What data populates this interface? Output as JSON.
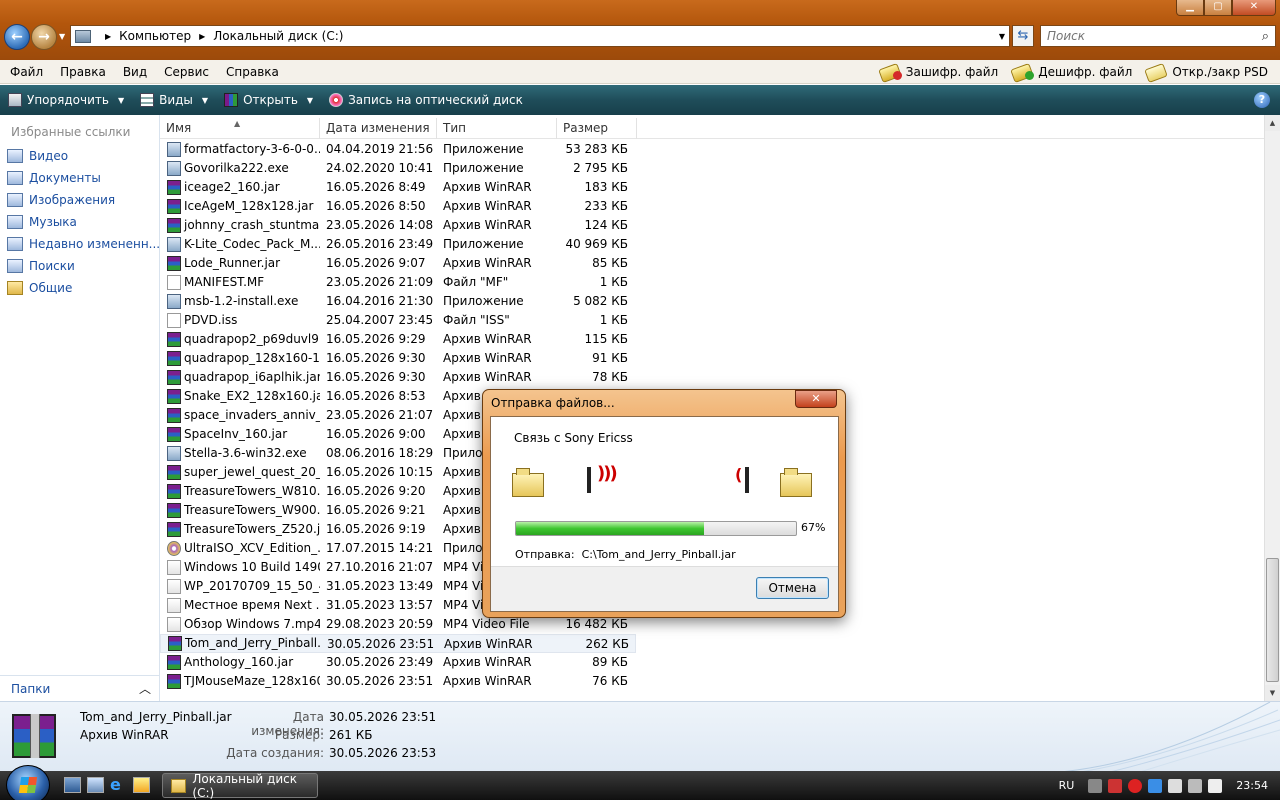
{
  "address": {
    "segments": [
      "Компьютер",
      "Локальный диск (C:)"
    ],
    "search_placeholder": "Поиск"
  },
  "menu": {
    "items": [
      "Файл",
      "Правка",
      "Вид",
      "Сервис",
      "Справка"
    ],
    "extras": [
      "Зашифр. файл",
      "Дешифр. файл",
      "Откр./закр PSD"
    ]
  },
  "toolbar": {
    "organize": "Упорядочить",
    "views": "Виды",
    "open": "Открыть",
    "burn": "Запись на оптический диск"
  },
  "nav": {
    "header": "Избранные ссылки",
    "links": [
      "Видео",
      "Документы",
      "Изображения",
      "Музыка",
      "Недавно измененн...",
      "Поиски",
      "Общие"
    ],
    "folders_label": "Папки"
  },
  "columns": [
    "Имя",
    "Дата изменения",
    "Тип",
    "Размер"
  ],
  "files": [
    {
      "name": "formatfactory-3-6-0-0...",
      "date": "04.04.2019 21:56",
      "type": "Приложение",
      "size": "53 283 КБ",
      "icon": "app"
    },
    {
      "name": "Govorilka222.exe",
      "date": "24.02.2020 10:41",
      "type": "Приложение",
      "size": "2 795 КБ",
      "icon": "app"
    },
    {
      "name": "iceage2_160.jar",
      "date": "16.05.2026 8:49",
      "type": "Архив WinRAR",
      "size": "183 КБ",
      "icon": "rar"
    },
    {
      "name": "IceAgeM_128x128.jar",
      "date": "16.05.2026 8:50",
      "type": "Архив WinRAR",
      "size": "233 КБ",
      "icon": "rar"
    },
    {
      "name": "johnny_crash_stuntma...",
      "date": "23.05.2026 14:08",
      "type": "Архив WinRAR",
      "size": "124 КБ",
      "icon": "rar"
    },
    {
      "name": "K-Lite_Codec_Pack_M...",
      "date": "26.05.2016 23:49",
      "type": "Приложение",
      "size": "40 969 КБ",
      "icon": "app"
    },
    {
      "name": "Lode_Runner.jar",
      "date": "16.05.2026 9:07",
      "type": "Архив WinRAR",
      "size": "85 КБ",
      "icon": "rar"
    },
    {
      "name": "MANIFEST.MF",
      "date": "23.05.2026 21:09",
      "type": "Файл \"MF\"",
      "size": "1 КБ",
      "icon": "txt"
    },
    {
      "name": "msb-1.2-install.exe",
      "date": "16.04.2016 21:30",
      "type": "Приложение",
      "size": "5 082 КБ",
      "icon": "app"
    },
    {
      "name": "PDVD.iss",
      "date": "25.04.2007 23:45",
      "type": "Файл \"ISS\"",
      "size": "1 КБ",
      "icon": "txt"
    },
    {
      "name": "quadrapop2_p69duvl9....",
      "date": "16.05.2026 9:29",
      "type": "Архив WinRAR",
      "size": "115 КБ",
      "icon": "rar"
    },
    {
      "name": "quadrapop_128x160-12...",
      "date": "16.05.2026 9:30",
      "type": "Архив WinRAR",
      "size": "91 КБ",
      "icon": "rar"
    },
    {
      "name": "quadrapop_i6aplhik.jar",
      "date": "16.05.2026 9:30",
      "type": "Архив WinRAR",
      "size": "78 КБ",
      "icon": "rar"
    },
    {
      "name": "Snake_EX2_128x160.jar",
      "date": "16.05.2026 8:53",
      "type": "Архив WinRAR",
      "size": "",
      "icon": "rar"
    },
    {
      "name": "space_invaders_anniv_...",
      "date": "23.05.2026 21:07",
      "type": "Архив WinRAR",
      "size": "",
      "icon": "rar"
    },
    {
      "name": "SpaceInv_160.jar",
      "date": "16.05.2026 9:00",
      "type": "Архив WinRAR",
      "size": "",
      "icon": "rar"
    },
    {
      "name": "Stella-3.6-win32.exe",
      "date": "08.06.2016 18:29",
      "type": "Приложение",
      "size": "",
      "icon": "app"
    },
    {
      "name": "super_jewel_quest_20_...",
      "date": "16.05.2026 10:15",
      "type": "Архив WinRAR",
      "size": "",
      "icon": "rar"
    },
    {
      "name": "TreasureTowers_W810....",
      "date": "16.05.2026 9:20",
      "type": "Архив WinRAR",
      "size": "",
      "icon": "rar"
    },
    {
      "name": "TreasureTowers_W900....",
      "date": "16.05.2026 9:21",
      "type": "Архив WinRAR",
      "size": "",
      "icon": "rar"
    },
    {
      "name": "TreasureTowers_Z520.jar",
      "date": "16.05.2026 9:19",
      "type": "Архив WinRAR",
      "size": "",
      "icon": "rar"
    },
    {
      "name": "UltraISO_XCV_Edition_...",
      "date": "17.07.2015 14:21",
      "type": "Приложение",
      "size": "",
      "icon": "iso"
    },
    {
      "name": "Windows 10 Build 1490...",
      "date": "27.10.2016 21:07",
      "type": "MP4 Video File",
      "size": "",
      "icon": "vid"
    },
    {
      "name": "WP_20170709_15_50_4...",
      "date": "31.05.2023 13:49",
      "type": "MP4 Video File",
      "size": "",
      "icon": "vid"
    },
    {
      "name": "Местное время Next ...",
      "date": "31.05.2023 13:57",
      "type": "MP4 Video File",
      "size": "",
      "icon": "vid"
    },
    {
      "name": "Обзор Windows 7.mp4",
      "date": "29.08.2023 20:59",
      "type": "MP4 Video File",
      "size": "16 482 КБ",
      "icon": "vid"
    },
    {
      "name": "Tom_and_Jerry_Pinball....",
      "date": "30.05.2026 23:51",
      "type": "Архив WinRAR",
      "size": "262 КБ",
      "icon": "rar",
      "selected": true
    },
    {
      "name": "Anthology_160.jar",
      "date": "30.05.2026 23:49",
      "type": "Архив WinRAR",
      "size": "89 КБ",
      "icon": "rar"
    },
    {
      "name": "TJMouseMaze_128x160....",
      "date": "30.05.2026 23:51",
      "type": "Архив WinRAR",
      "size": "76 КБ",
      "icon": "rar"
    }
  ],
  "details": {
    "name": "Tom_and_Jerry_Pinball.jar",
    "type": "Архив WinRAR",
    "modified_label": "Дата изменения:",
    "modified": "30.05.2026 23:51",
    "size_label": "Размер:",
    "size": "261 КБ",
    "created_label": "Дата создания:",
    "created": "30.05.2026 23:53"
  },
  "dialog": {
    "title": "Отправка файлов...",
    "connection": "Связь с Sony Ericss",
    "progress": 0.67,
    "progress_label": "67%",
    "sending_label": "Отправка:",
    "sending_path": "C:\\Tom_and_Jerry_Pinball.jar",
    "cancel": "Отмена"
  },
  "taskbar": {
    "window": "Локальный диск (C:)",
    "lang": "RU",
    "time": "23:54"
  }
}
